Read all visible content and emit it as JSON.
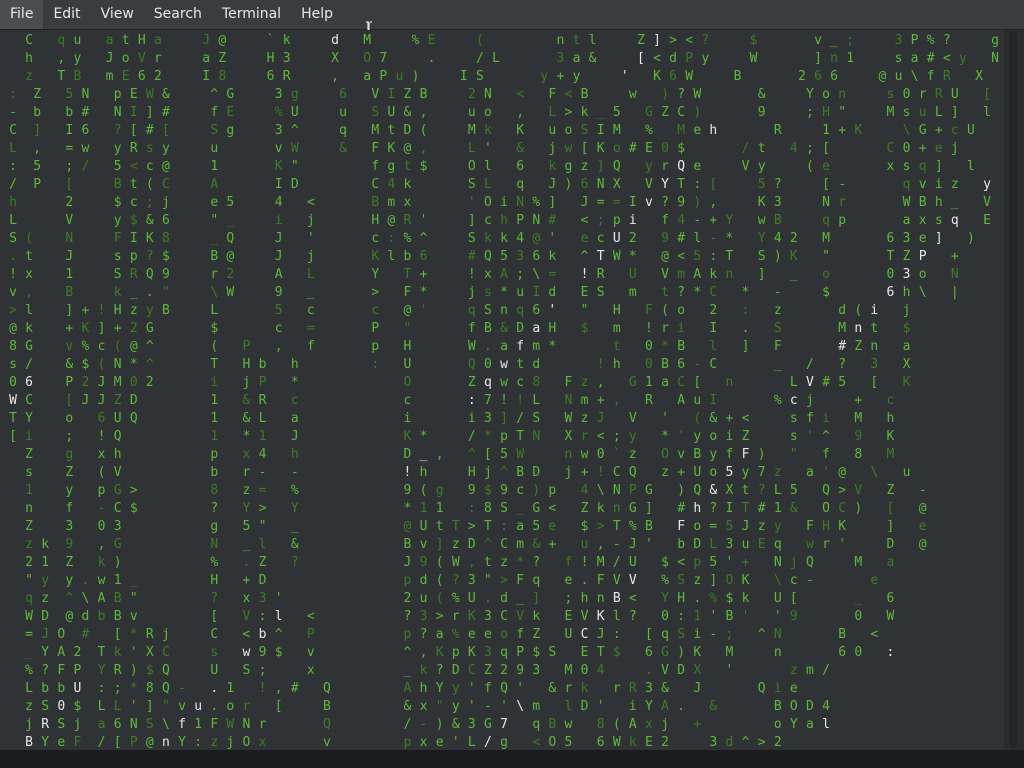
{
  "menubar": {
    "items": [
      "File",
      "Edit",
      "View",
      "Search",
      "Terminal",
      "Help"
    ]
  },
  "colors": {
    "green": "#5fb83a",
    "dim_green": "#3f7a28",
    "white": "#e8e8e8",
    "background": "#303335"
  },
  "icons": {
    "mouse_cursor": "ibeam-cursor-icon"
  },
  "terminal": {
    "rows": [
      "  C   q u   a t H a     J @     ` k     d   M     % E     (         n t l     Z ] > < ?     $       v _ ;     3 P % ?     g",
      "  h   , y   J o V r     a Z     H 3     X   O 7     .     / L       3 a &     [ < d P y     W       ] n 1     s a # < y   N",
      "  z   T B   m E 6 2     I 8     6 R     ,   a P u )     I S       y + y     '   K 6 W     B       2 6 6     @ u \\ f R   X",
      ":  Z   5 N   p E W &     ^ G     3 g     6   V I Z B     2 N   <   F < B     w   ) ? W       &     Y o n     s 0 r R U   [",
      "-  b   b #   N I ] #     f E     % U     u   S U & ,     u o   ,   L > k _ 5   G Z C )       9     ; H \"     M s u L ]   l",
      "C  ]   I 6   ? [ # [     S g     3 ^     q   M t D (     M k   K   u o S I M   %   M e h       R     1 + K     \\ G + c U   (",
      "L  ,   = w   y R s y     u       v W     &   F K @ ,     L '   &   j w [ K o # E 0 $       / t   4 ; [       C 0 + e j",
      ":  5   ; /   5 < c @     1       K \"         f g t $     O l   6   k g z ] Q   y r Q e     V y     ( e       x s q ]   l",
      "/  P   [     B t ( C     A       I D         C 4 k       S L   q   J ) 6 N X   V Y T : [     5 ?     [ -       q v i z   y",
      "h      2     $ c ; j     e 5     4   <       B m x       ' O i N % ]   J = = I v ? 9 ) ,     K 3     N r       W B h _   V",
      "L      V     y $ & 6     \" _     i   j       H @ R '     ] c h P N #   < ; p i   f 4 - + Y   w B     q p       a x s q   E",
      "S (    N     F I K 8     _ Q     J   '       c : % ^     S k k 4 @ '   e c U 2   9 # l - *   Y 4 2   M       6 3 e ]   )",
      ". t    J     s p ? $     B @     J   j       K l b 6     # Q 5 3 6 k   ^ T W *   @ < 5 : T   S ) K   \"       T Z P   +",
      "! x    1     S R Q 9     r 2     A   L       Y   T +     ! x A ; \\ =   ! R   U   V m A k n   ]   _   o       0 3 o   N",
      "v ,    B     k _ . \"     \\ W     9   _       >   F *     j s * u I d   E S   m   t ? * C   *   -     $       6 h \\   |",
      "> l    ] + ! H z y B     L       5   c       c   @ '     q S n q 6 '   \"   H   F ( o   2   :   z       d ( i   j",
      "@ k    + K ] + 2 G       $       c   =       P   \"       f B & D a H   $   m   ! r i   I   .   S       M n t   $",
      "8 G    v % c ( @ ^       (   P   ,   f       p   H       W . a f m *       t   0 * B   l   ]   F       # Z n   a",
      "s /    & $ ( N * ^       T   H b   h         :   U       Q 0 w t d       ! h   0 B 6 - C       _   /   ?   3   X",
      "0 6    P 2 J M 0 2       i   j P   *             O       Z q w c 8   F z ,   G 1 a C [   n       L V # 5   [   K",
      "W C    [ J J Z D         1   & R   c             c       : 7 ! ! L   N m + ,   R   A u I       % c j     +   c",
      "T Y    o   6 U Q         1   & L   a             i       i 3 ] / S   W z J   V   '   ( & + <     s f i   M   h",
      "[ i    ;   ! Q           1   * 1   J             K *     / * p T N   X r < ; y   * ' y o i Z     s ' ^   9   K",
      "  Z    g   x h           p   x 4   h             D _ ,   ^ [ 5 W     n w 0 ` z   O v B y f F )   \"   f   8   M",
      "  s    Z   ( V           b   r -   -             ! h     H j ^ B D   j + ! C Q   z + U o 5 y 7 z   a ' @   \\   u",
      "  1    y   p G >         8   z =   %             9 ( g   9 $ 9 c ) p   4 \\ N P G   ) Q & X t ? L 5   Q > V   Z   -",
      "  n    f   - C $         ?   Y >   Y             * 1 1   : 8 S _ G <   Z k n G ]   # h ? I T # 1 &   O C )   [   @",
      "  Z    3   0 3           g   5 \"   _             @ U t T > T : a 5 e   $ > T % B   F o = 5 J z y   F H K     ]   e",
      "  z k  9   , G           N   _ l   &             B v ] z D ^ C m & +   u , - J '   b D L 3 u E q   w r '     D   @",
      "  2 1  Z   k )           %   . Z   ?             J 9 ( W , t z * ?   f ! M / U   $ < p 5 ' +   N j Q     M   a",
      "  \" y  y . w 1 _         H   + D                 p d ( ? 3 \" > F q   e . F V V   % S z ] O K   \\ c -       e",
      "  q z  ^ \\ A B \"         ?   x 3 '               2 u ( % U . d _ ]   ; h n B <   Y H . % $ k   U [       _   6",
      "  W D  @ d b B v         [   V : l   <           ? 3 > r K 3 C V k   E V K l ?   0 : 1 ' B '   ' 9       0   W",
      "  = J O  #   [ * R j     C   < b ^   P           p ? a % e e o f Z   U C J :   [ q S i - ;   ^ N       B   <",
      "  _ Y A 2  T k ' X C     s   w 9 $   v           ^ , K p K 3 q P $ S   E T $   6 G ) K   M     n       6 0   :",
      "  % ? F P  Y R ) $ Q     U   S ;     x           _ k ? D C Z 2 9 3   M 0 4     . V D X   '       z m /",
      "  L b b U  : ; * 8 Q -   . 1   ! , #   Q         A h Y y ' f Q '   & r k   r R 3 &   J       Q i e",
      "  z S 0 $  L L ' ] \" v u . o r   [     B         & x \" y ' - ' \\ m   l D '   i Y A .   &       B O D 4",
      "  j R S j  a 6 N S \\ f 1 F W N r       Q         / - ) & 3 G 7   q B w   8 ( A x j   +         o Y a l",
      "  B Y e F  / [ P @ n Y : z j O x       v         p x e ' L / g   < O 5   6 W k E 2     3 d ^ > 2"
    ]
  }
}
